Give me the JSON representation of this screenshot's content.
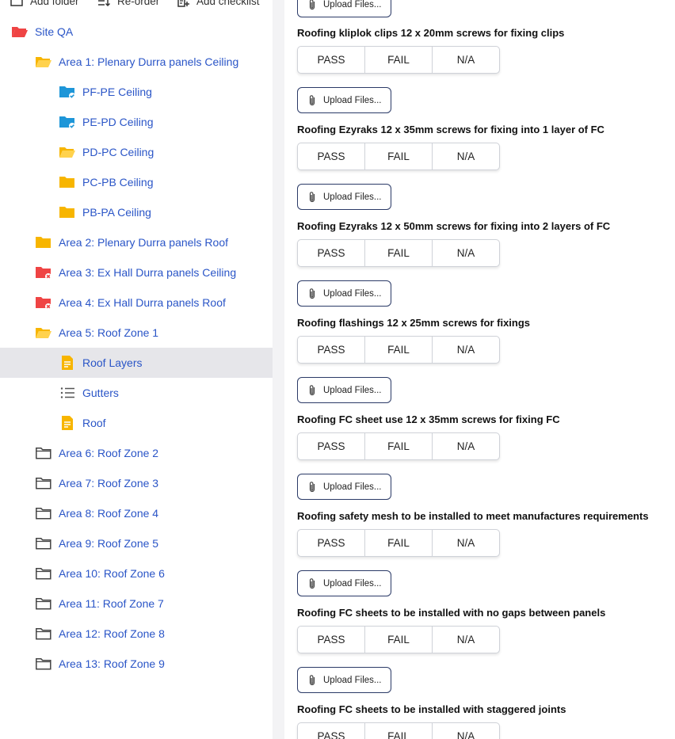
{
  "toolbar": {
    "add_folder": "Add folder",
    "reorder": "Re-order",
    "add_checklist": "Add checklist"
  },
  "tree": [
    {
      "label": "Site QA",
      "icon": "folder-open-red-icon"
    },
    {
      "label": "Area 1: Plenary Durra panels Ceiling",
      "icon": "folder-open-yellow-icon"
    },
    {
      "label": "PF-PE Ceiling",
      "icon": "folder-blue-check-icon"
    },
    {
      "label": "PE-PD Ceiling",
      "icon": "folder-blue-check-icon"
    },
    {
      "label": "PD-PC Ceiling",
      "icon": "folder-open-yellow-icon"
    },
    {
      "label": "PC-PB Ceiling",
      "icon": "folder-yellow-icon"
    },
    {
      "label": "PB-PA Ceiling",
      "icon": "folder-yellow-icon"
    },
    {
      "label": "Area 2: Plenary Durra panels Roof",
      "icon": "folder-yellow-icon"
    },
    {
      "label": "Area 3: Ex Hall Durra panels Ceiling",
      "icon": "folder-red-x-icon"
    },
    {
      "label": "Area 4: Ex Hall Durra panels Roof",
      "icon": "folder-red-x-icon"
    },
    {
      "label": "Area 5: Roof Zone 1",
      "icon": "folder-open-yellow-icon"
    },
    {
      "label": "Roof Layers",
      "icon": "document-icon"
    },
    {
      "label": "Gutters",
      "icon": "list-icon"
    },
    {
      "label": "Roof",
      "icon": "document-icon"
    },
    {
      "label": "Area 6: Roof Zone 2",
      "icon": "folder-outline-icon"
    },
    {
      "label": "Area 7: Roof Zone 3",
      "icon": "folder-outline-icon"
    },
    {
      "label": "Area 8: Roof Zone 4",
      "icon": "folder-outline-icon"
    },
    {
      "label": "Area 9: Roof Zone 5",
      "icon": "folder-outline-icon"
    },
    {
      "label": "Area 10: Roof Zone 6",
      "icon": "folder-outline-icon"
    },
    {
      "label": "Area 11: Roof Zone 7",
      "icon": "folder-outline-icon"
    },
    {
      "label": "Area 12: Roof Zone 8",
      "icon": "folder-outline-icon"
    },
    {
      "label": "Area 13: Roof Zone 9",
      "icon": "folder-outline-icon"
    }
  ],
  "active_item": "Roof Layers",
  "options": {
    "pass": "PASS",
    "fail": "FAIL",
    "na": "N/A"
  },
  "upload_label": "Upload Files...",
  "questions": [
    "Roofing kliplok clips 12 x 20mm screws for fixing clips",
    "Roofing Ezyraks 12 x 35mm screws for fixing into 1 layer of FC",
    "Roofing Ezyraks 12 x 50mm screws for fixing into 2 layers of FC",
    "Roofing flashings 12 x 25mm screws for fixings",
    "Roofing FC sheet use 12 x 35mm screws for fixing FC",
    "Roofing safety mesh to be installed to meet manufactures requirements",
    "Roofing FC sheets to be installed with no gaps between panels",
    "Roofing FC sheets to be installed with staggered joints"
  ],
  "colors": {
    "link_blue": "#2a55c7",
    "folder_yellow": "#f7b500",
    "folder_red": "#ef4444",
    "folder_blue": "#1e96d8",
    "active_bg": "#e6e6ea"
  }
}
